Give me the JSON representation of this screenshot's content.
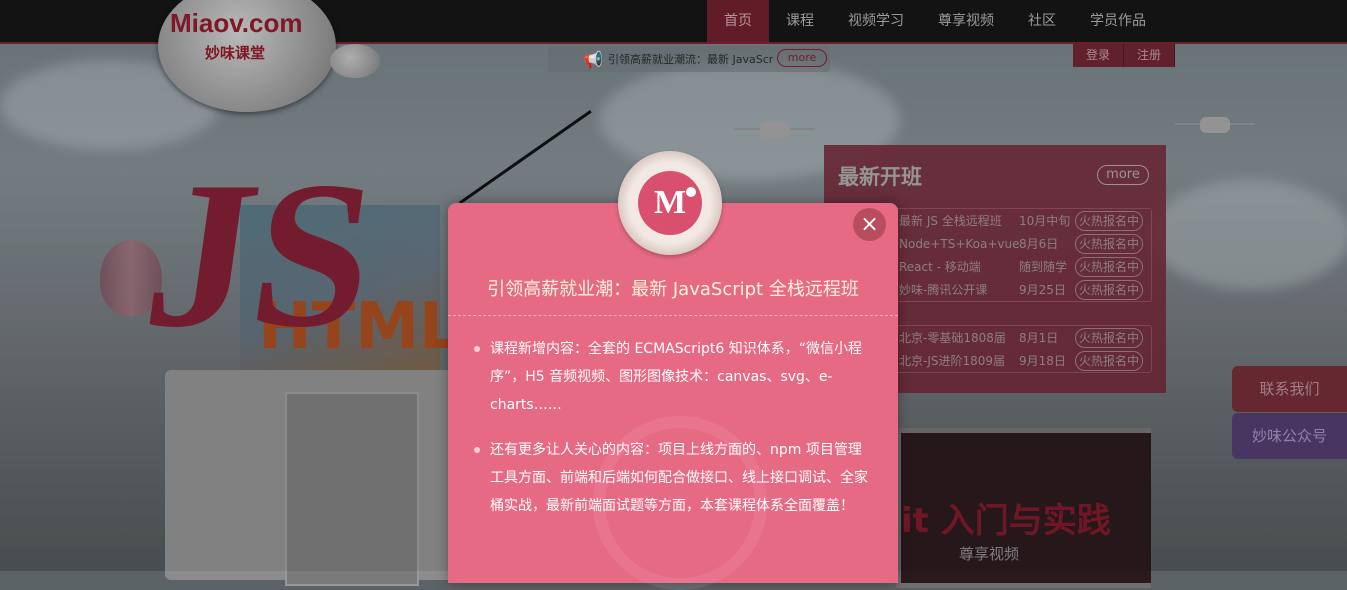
{
  "logo": {
    "text": "Miaov.com",
    "subtitle": "妙味课堂"
  },
  "nav": {
    "items": [
      "首页",
      "课程",
      "视频学习",
      "尊享视频",
      "社区",
      "学员作品"
    ]
  },
  "auth": {
    "login": "登录",
    "register": "注册"
  },
  "ticker": {
    "text": "引领高薪就业潮流：最新 JavaScript",
    "more": "more"
  },
  "art": {
    "js": "JS",
    "html": "HTML"
  },
  "classes": {
    "title": "最新开班",
    "more": "more",
    "group1": [
      {
        "name": "最新 JS 全栈远程班",
        "date": "10月中旬",
        "btn": "火热报名中"
      },
      {
        "name": "Node+TS+Koa+vue",
        "date": "8月6日",
        "btn": "火热报名中"
      },
      {
        "name": "React - 移动端",
        "date": "随到随学",
        "btn": "火热报名中"
      },
      {
        "name": "妙味-腾讯公开课",
        "date": "9月25日",
        "btn": "火热报名中"
      }
    ],
    "group2": [
      {
        "name": "北京-零基础1808届",
        "date": "8月1日",
        "btn": "火热报名中"
      },
      {
        "name": "北京-JS进阶1809届",
        "date": "9月18日",
        "btn": "火热报名中"
      }
    ]
  },
  "side": {
    "contact": "联系我们",
    "wechat": "妙味公众号"
  },
  "billboard": {
    "title": "it 入门与实践",
    "sub": "尊享视频"
  },
  "modal": {
    "badge": "M",
    "close": "×",
    "title": "引领高薪就业潮：最新 JavaScript 全栈远程班",
    "para1": "课程新增内容：全套的 ECMAScript6 知识体系，“微信小程序”，H5 音频视频、图形图像技术：canvas、svg、e-charts……",
    "para2": "还有更多让人关心的内容：项目上线方面的、npm 项目管理工具方面、前端和后端如何配合做接口、线上接口调试、全家桶实战，最新前端面试题等方面，本套课程体系全面覆盖！"
  },
  "colors": {
    "accent": "#e66a84",
    "brand": "#8a1a2a"
  }
}
